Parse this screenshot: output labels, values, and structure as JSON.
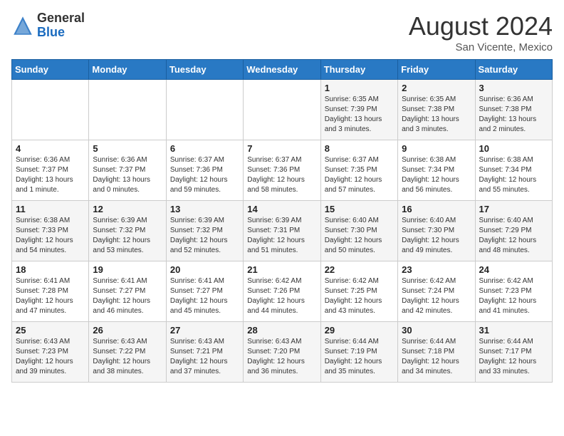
{
  "header": {
    "logo_general": "General",
    "logo_blue": "Blue",
    "month_year": "August 2024",
    "location": "San Vicente, Mexico"
  },
  "days_of_week": [
    "Sunday",
    "Monday",
    "Tuesday",
    "Wednesday",
    "Thursday",
    "Friday",
    "Saturday"
  ],
  "weeks": [
    [
      {
        "day": "",
        "detail": ""
      },
      {
        "day": "",
        "detail": ""
      },
      {
        "day": "",
        "detail": ""
      },
      {
        "day": "",
        "detail": ""
      },
      {
        "day": "1",
        "detail": "Sunrise: 6:35 AM\nSunset: 7:39 PM\nDaylight: 13 hours\nand 3 minutes."
      },
      {
        "day": "2",
        "detail": "Sunrise: 6:35 AM\nSunset: 7:38 PM\nDaylight: 13 hours\nand 3 minutes."
      },
      {
        "day": "3",
        "detail": "Sunrise: 6:36 AM\nSunset: 7:38 PM\nDaylight: 13 hours\nand 2 minutes."
      }
    ],
    [
      {
        "day": "4",
        "detail": "Sunrise: 6:36 AM\nSunset: 7:37 PM\nDaylight: 13 hours\nand 1 minute."
      },
      {
        "day": "5",
        "detail": "Sunrise: 6:36 AM\nSunset: 7:37 PM\nDaylight: 13 hours\nand 0 minutes."
      },
      {
        "day": "6",
        "detail": "Sunrise: 6:37 AM\nSunset: 7:36 PM\nDaylight: 12 hours\nand 59 minutes."
      },
      {
        "day": "7",
        "detail": "Sunrise: 6:37 AM\nSunset: 7:36 PM\nDaylight: 12 hours\nand 58 minutes."
      },
      {
        "day": "8",
        "detail": "Sunrise: 6:37 AM\nSunset: 7:35 PM\nDaylight: 12 hours\nand 57 minutes."
      },
      {
        "day": "9",
        "detail": "Sunrise: 6:38 AM\nSunset: 7:34 PM\nDaylight: 12 hours\nand 56 minutes."
      },
      {
        "day": "10",
        "detail": "Sunrise: 6:38 AM\nSunset: 7:34 PM\nDaylight: 12 hours\nand 55 minutes."
      }
    ],
    [
      {
        "day": "11",
        "detail": "Sunrise: 6:38 AM\nSunset: 7:33 PM\nDaylight: 12 hours\nand 54 minutes."
      },
      {
        "day": "12",
        "detail": "Sunrise: 6:39 AM\nSunset: 7:32 PM\nDaylight: 12 hours\nand 53 minutes."
      },
      {
        "day": "13",
        "detail": "Sunrise: 6:39 AM\nSunset: 7:32 PM\nDaylight: 12 hours\nand 52 minutes."
      },
      {
        "day": "14",
        "detail": "Sunrise: 6:39 AM\nSunset: 7:31 PM\nDaylight: 12 hours\nand 51 minutes."
      },
      {
        "day": "15",
        "detail": "Sunrise: 6:40 AM\nSunset: 7:30 PM\nDaylight: 12 hours\nand 50 minutes."
      },
      {
        "day": "16",
        "detail": "Sunrise: 6:40 AM\nSunset: 7:30 PM\nDaylight: 12 hours\nand 49 minutes."
      },
      {
        "day": "17",
        "detail": "Sunrise: 6:40 AM\nSunset: 7:29 PM\nDaylight: 12 hours\nand 48 minutes."
      }
    ],
    [
      {
        "day": "18",
        "detail": "Sunrise: 6:41 AM\nSunset: 7:28 PM\nDaylight: 12 hours\nand 47 minutes."
      },
      {
        "day": "19",
        "detail": "Sunrise: 6:41 AM\nSunset: 7:27 PM\nDaylight: 12 hours\nand 46 minutes."
      },
      {
        "day": "20",
        "detail": "Sunrise: 6:41 AM\nSunset: 7:27 PM\nDaylight: 12 hours\nand 45 minutes."
      },
      {
        "day": "21",
        "detail": "Sunrise: 6:42 AM\nSunset: 7:26 PM\nDaylight: 12 hours\nand 44 minutes."
      },
      {
        "day": "22",
        "detail": "Sunrise: 6:42 AM\nSunset: 7:25 PM\nDaylight: 12 hours\nand 43 minutes."
      },
      {
        "day": "23",
        "detail": "Sunrise: 6:42 AM\nSunset: 7:24 PM\nDaylight: 12 hours\nand 42 minutes."
      },
      {
        "day": "24",
        "detail": "Sunrise: 6:42 AM\nSunset: 7:23 PM\nDaylight: 12 hours\nand 41 minutes."
      }
    ],
    [
      {
        "day": "25",
        "detail": "Sunrise: 6:43 AM\nSunset: 7:23 PM\nDaylight: 12 hours\nand 39 minutes."
      },
      {
        "day": "26",
        "detail": "Sunrise: 6:43 AM\nSunset: 7:22 PM\nDaylight: 12 hours\nand 38 minutes."
      },
      {
        "day": "27",
        "detail": "Sunrise: 6:43 AM\nSunset: 7:21 PM\nDaylight: 12 hours\nand 37 minutes."
      },
      {
        "day": "28",
        "detail": "Sunrise: 6:43 AM\nSunset: 7:20 PM\nDaylight: 12 hours\nand 36 minutes."
      },
      {
        "day": "29",
        "detail": "Sunrise: 6:44 AM\nSunset: 7:19 PM\nDaylight: 12 hours\nand 35 minutes."
      },
      {
        "day": "30",
        "detail": "Sunrise: 6:44 AM\nSunset: 7:18 PM\nDaylight: 12 hours\nand 34 minutes."
      },
      {
        "day": "31",
        "detail": "Sunrise: 6:44 AM\nSunset: 7:17 PM\nDaylight: 12 hours\nand 33 minutes."
      }
    ]
  ]
}
